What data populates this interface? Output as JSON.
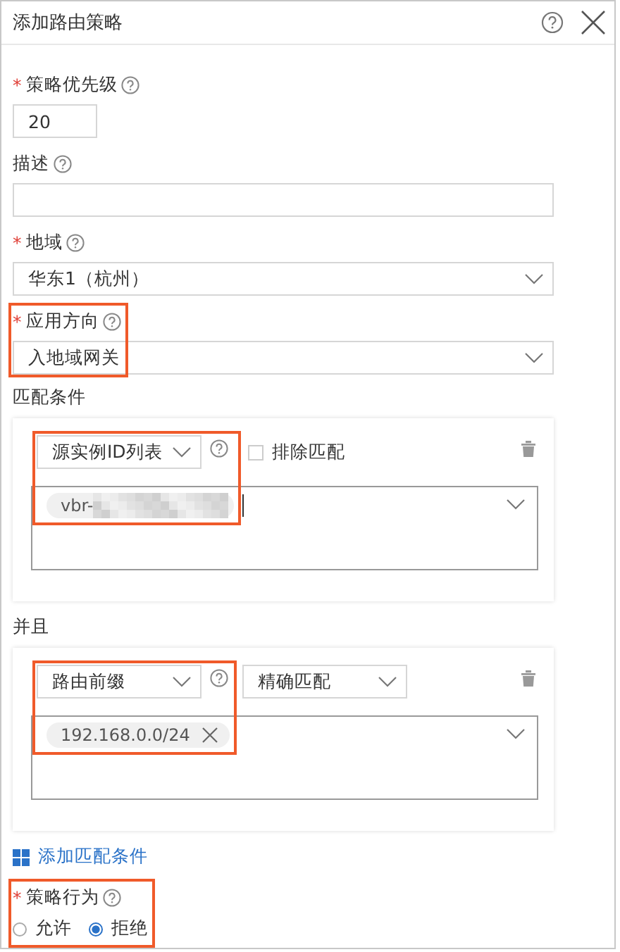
{
  "dialog": {
    "title": "添加路由策略"
  },
  "fields": [
    {
      "kind": "number",
      "label": "策略优先级",
      "required_mark": "*",
      "value": "20",
      "highlighted": false
    },
    {
      "kind": "text",
      "label": "描述",
      "highlighted": false
    },
    {
      "kind": "select",
      "label": "地域",
      "required_mark": "*",
      "value": "华东1（杭州）",
      "highlighted": false
    },
    {
      "kind": "select",
      "label": "应用方向",
      "required_mark": "*",
      "value": "入地域网关",
      "highlighted": true
    }
  ],
  "conditions": [
    {
      "heading": "匹配条件",
      "type": "源实例ID列表",
      "exclude": {
        "label": "排除匹配",
        "checked": false
      },
      "tags": [
        {
          "text": "vbr-",
          "redacted": true,
          "removable": false
        }
      ],
      "cursor": true,
      "highlighted": true
    },
    {
      "heading": "并且",
      "type": "路由前缀",
      "mode": "精确匹配",
      "tags": [
        {
          "text": "192.168.0.0/24",
          "redacted": false,
          "removable": true
        }
      ],
      "cursor": false,
      "highlighted": true
    }
  ],
  "add_condition": "添加匹配条件",
  "action": {
    "label": "策略行为",
    "required_mark": "*",
    "highlighted": true,
    "options": [
      {
        "label": "允许",
        "selected": false
      },
      {
        "label": "拒绝",
        "selected": true
      }
    ]
  }
}
